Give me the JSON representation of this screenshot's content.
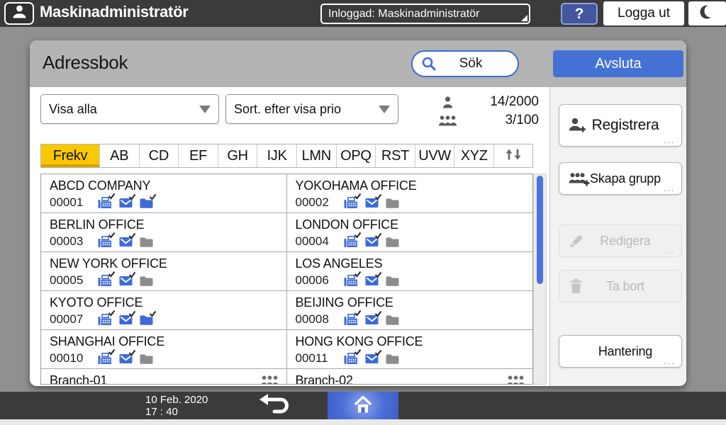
{
  "top_bar": {
    "title": "Maskinadministratör",
    "login_dropdown": "Inloggad: Maskinadministratör",
    "help_label": "?",
    "logout_label": "Logga ut"
  },
  "panel": {
    "title": "Adressbok",
    "search_label": "Sök",
    "exit_label": "Avsluta",
    "display_filter": "Visa alla",
    "sort_filter": "Sort. efter visa prio",
    "user_count": "14/2000",
    "group_count": "3/100",
    "tabs": [
      "Frekv",
      "AB",
      "CD",
      "EF",
      "GH",
      "IJK",
      "LMN",
      "OPQ",
      "RST",
      "UVW",
      "XYZ"
    ],
    "active_tab": "Frekv"
  },
  "contacts": [
    {
      "name": "ABCD COMPANY",
      "id": "00001",
      "fax": true,
      "email": true,
      "folder": true
    },
    {
      "name": "YOKOHAMA OFFICE",
      "id": "00002",
      "fax": true,
      "email": true,
      "folder": false
    },
    {
      "name": "BERLIN OFFICE",
      "id": "00003",
      "fax": true,
      "email": true,
      "folder": false
    },
    {
      "name": "LONDON OFFICE",
      "id": "00004",
      "fax": true,
      "email": true,
      "folder": false
    },
    {
      "name": "NEW YORK OFFICE",
      "id": "00005",
      "fax": true,
      "email": true,
      "folder": false
    },
    {
      "name": "LOS ANGELES",
      "id": "00006",
      "fax": true,
      "email": true,
      "folder": false
    },
    {
      "name": "KYOTO OFFICE",
      "id": "00007",
      "fax": true,
      "email": true,
      "folder": true
    },
    {
      "name": "BEIJING OFFICE",
      "id": "00008",
      "fax": true,
      "email": true,
      "folder": false
    },
    {
      "name": "SHANGHAI OFFICE",
      "id": "00010",
      "fax": true,
      "email": true,
      "folder": false
    },
    {
      "name": "HONG KONG OFFICE",
      "id": "00011",
      "fax": true,
      "email": true,
      "folder": false
    },
    {
      "name": "Branch-01",
      "type": "group"
    },
    {
      "name": "Branch-02",
      "type": "group"
    }
  ],
  "actions": [
    {
      "name": "register-button",
      "label": "Registrera",
      "icon": "person-add",
      "enabled": true,
      "more": true,
      "tall": true
    },
    {
      "name": "create-group-button",
      "label": "Skapa grupp",
      "icon": "group-add",
      "enabled": true,
      "more": true,
      "tall": false
    },
    {
      "name": "edit-button",
      "label": "Redigera",
      "icon": "pencil",
      "enabled": false,
      "more": true,
      "tall": false
    },
    {
      "name": "delete-button",
      "label": "Ta bort",
      "icon": "trash",
      "enabled": false,
      "more": false,
      "tall": false
    },
    {
      "name": "management-button",
      "label": "Hantering",
      "icon": null,
      "enabled": true,
      "more": true,
      "tall": false
    }
  ],
  "bottom_bar": {
    "date": "10 Feb. 2020",
    "time": "17 : 40"
  },
  "ui": {
    "more_indicator": "..."
  },
  "colors": {
    "accent_blue": "#3e6bd8",
    "button_blue": "#4472d4",
    "tab_active_yellow": "#f8c804",
    "topbar_bg": "#3b3b3b",
    "desktop_bg": "#909090",
    "header_gray": "#b3b3b3",
    "disabled_gray": "#b9b9b9"
  }
}
